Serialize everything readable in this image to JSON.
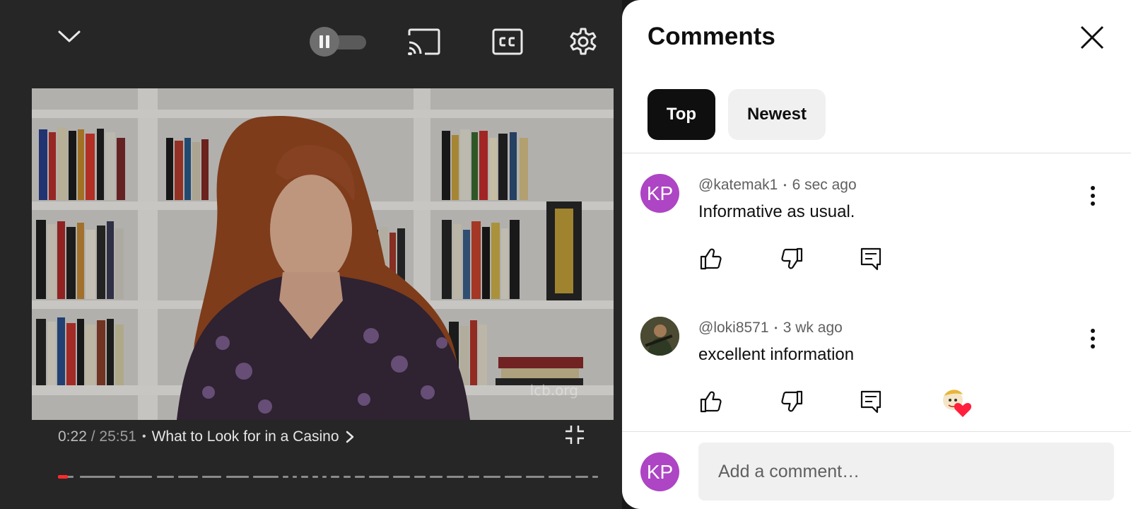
{
  "player": {
    "current_time": "0:22",
    "time_separator": " / ",
    "duration": "25:51",
    "separator": "•",
    "video_title": "What to Look for in a Casino",
    "watermark": "lcb.org",
    "progress_fraction": 0.009,
    "accent_color": "#ff2a2a",
    "icons": [
      "chevron-down-icon",
      "pause-icon",
      "cast-icon",
      "closed-captions-icon",
      "settings-gear-icon",
      "chevron-right-icon",
      "fullscreen-exit-icon"
    ]
  },
  "comments_panel": {
    "title": "Comments",
    "sort_chips": [
      {
        "label": "Top",
        "selected": true
      },
      {
        "label": "Newest",
        "selected": false
      }
    ],
    "comments": [
      {
        "avatar_initials": "KP",
        "avatar_color": "#ad45c4",
        "author": "@katemak1",
        "separator": "•",
        "timestamp": "6 sec ago",
        "text": "Informative as usual.",
        "creator_heart": false
      },
      {
        "avatar_initials": "",
        "author": "@loki8571",
        "separator": "•",
        "timestamp": "3 wk ago",
        "text": "excellent information",
        "creator_heart": true
      }
    ],
    "compose": {
      "avatar_initials": "KP",
      "placeholder": "Add a comment…"
    }
  }
}
